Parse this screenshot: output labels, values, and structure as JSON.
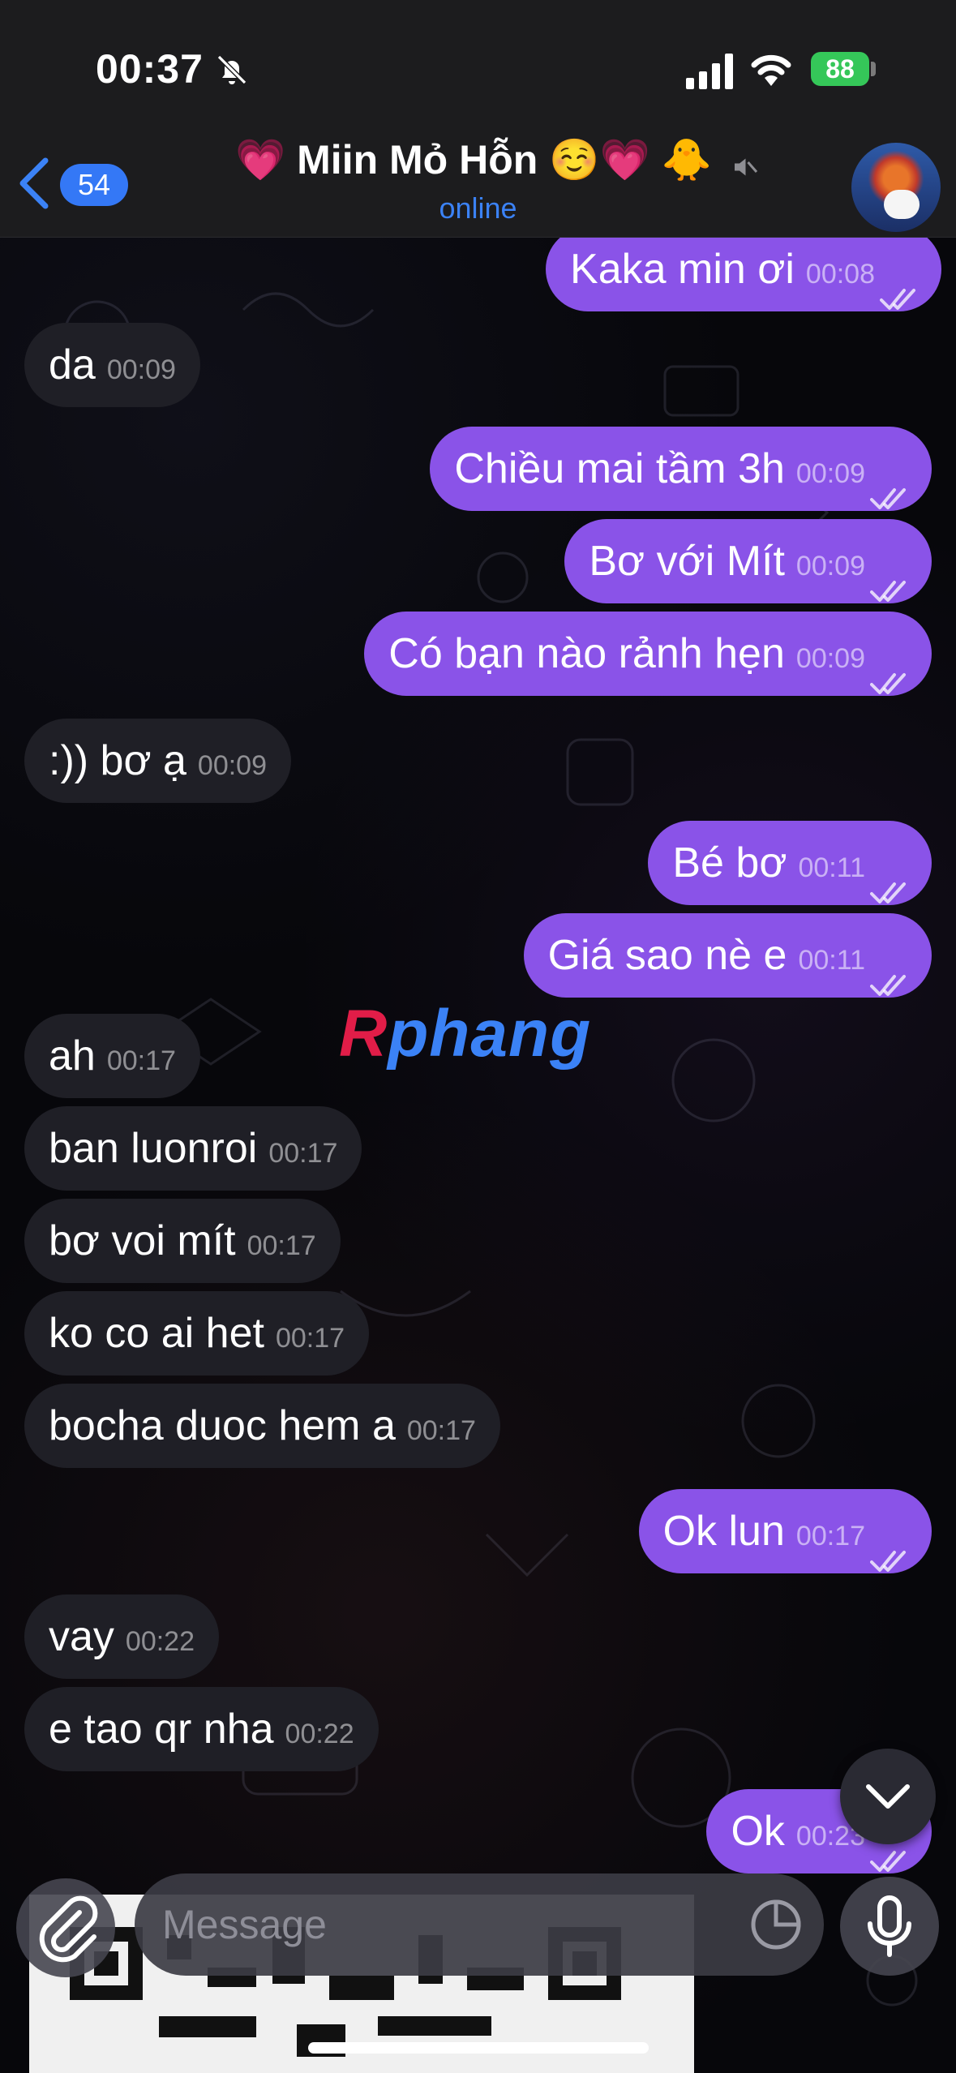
{
  "status_bar": {
    "time": "00:37",
    "battery": "88"
  },
  "header": {
    "back_count": "54",
    "title": "💗 Miin Mỏ Hỗn ☺️💗 🐥",
    "subtitle": "online"
  },
  "watermark": {
    "r": "R",
    "rest": "phang"
  },
  "messages": [
    {
      "dir": "out",
      "text": "Kaka min ơi",
      "time": "00:08"
    },
    {
      "dir": "in",
      "text": "da",
      "time": "00:09"
    },
    {
      "dir": "out",
      "text": "Chiều mai tầm 3h",
      "time": "00:09"
    },
    {
      "dir": "out",
      "text": "Bơ với Mít",
      "time": "00:09"
    },
    {
      "dir": "out",
      "text": "Có bạn nào rảnh hẹn",
      "time": "00:09"
    },
    {
      "dir": "in",
      "text": ":)) bơ ạ",
      "time": "00:09"
    },
    {
      "dir": "out",
      "text": "Bé bơ",
      "time": "00:11"
    },
    {
      "dir": "out",
      "text": "Giá sao nè e",
      "time": "00:11"
    },
    {
      "dir": "in",
      "text": "ah",
      "time": "00:17"
    },
    {
      "dir": "in",
      "text": "ban luonroi",
      "time": "00:17"
    },
    {
      "dir": "in",
      "text": "bơ voi mít",
      "time": "00:17"
    },
    {
      "dir": "in",
      "text": "ko co ai het",
      "time": "00:17"
    },
    {
      "dir": "in",
      "text": "bocha duoc hem a",
      "time": "00:17"
    },
    {
      "dir": "out",
      "text": "Ok lun",
      "time": "00:17"
    },
    {
      "dir": "in",
      "text": "vay",
      "time": "00:22"
    },
    {
      "dir": "in",
      "text": "e tao qr nha",
      "time": "00:22"
    },
    {
      "dir": "out",
      "text": "Ok",
      "time": "00:23"
    }
  ],
  "composer": {
    "placeholder": "Message"
  }
}
